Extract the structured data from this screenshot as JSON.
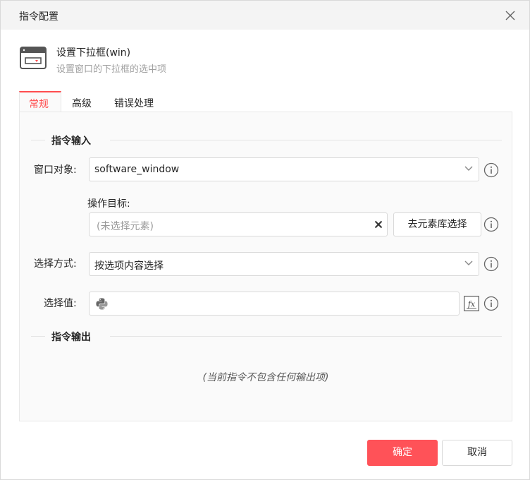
{
  "dialog": {
    "title": "指令配置"
  },
  "command": {
    "name": "设置下拉框(win)",
    "description": "设置窗口的下拉框的选中项",
    "icon": "dropdown-window-icon"
  },
  "tabs": [
    {
      "label": "常规",
      "active": true
    },
    {
      "label": "高级",
      "active": false
    },
    {
      "label": "错误处理",
      "active": false
    }
  ],
  "input_section": {
    "title": "指令输入",
    "window_object": {
      "label": "窗口对象:",
      "value": "software_window"
    },
    "operation_target": {
      "label": "操作目标:",
      "placeholder": "(未选择元素)",
      "library_button": "去元素库选择"
    },
    "select_mode": {
      "label": "选择方式:",
      "value": "按选项内容选择"
    },
    "select_value": {
      "label": "选择值:",
      "value": ""
    }
  },
  "output_section": {
    "title": "指令输出",
    "empty_text": "(当前指令不包含任何输出项)"
  },
  "footer": {
    "confirm_label": "确定",
    "cancel_label": "取消"
  },
  "colors": {
    "accent": "#ff4d4f",
    "primary_button": "#ff5258"
  }
}
